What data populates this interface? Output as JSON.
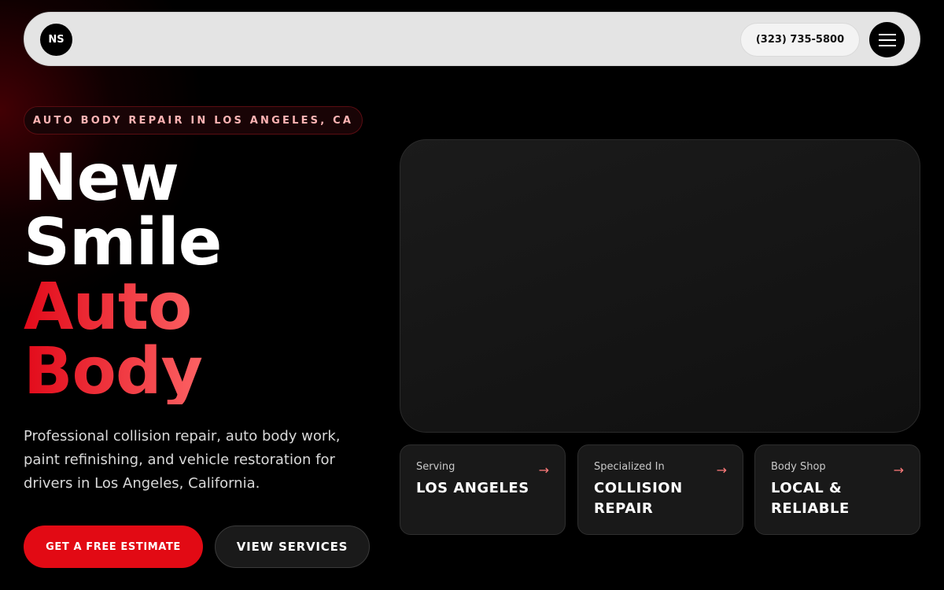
{
  "nav": {
    "logo": "NS",
    "phone": "(323) 735-5800",
    "menu_icon": "hamburger-icon"
  },
  "hero": {
    "badge": "AUTO BODY REPAIR IN LOS ANGELES, CA",
    "headline": {
      "line1": "New",
      "line2": "Smile",
      "line3": "Auto",
      "line4": "Body"
    },
    "description": "Professional collision repair, auto body work, paint refinishing, and vehicle restoration for drivers in Los Angeles, California.",
    "primary_button": "GET A FREE ESTIMATE",
    "secondary_button": "VIEW SERVICES"
  },
  "cards": [
    {
      "label": "Serving",
      "value": "LOS ANGELES",
      "icon": "arrow-right-icon"
    },
    {
      "label": "Specialized In",
      "value": "COLLISION REPAIR",
      "icon": "arrow-right-icon"
    },
    {
      "label": "Body Shop",
      "value": "LOCAL & RELIABLE",
      "icon": "arrow-right-icon"
    }
  ],
  "colors": {
    "accent": "#e20a14",
    "badge_text": "#ffb4b4",
    "arrow": "#ff7a7a"
  }
}
